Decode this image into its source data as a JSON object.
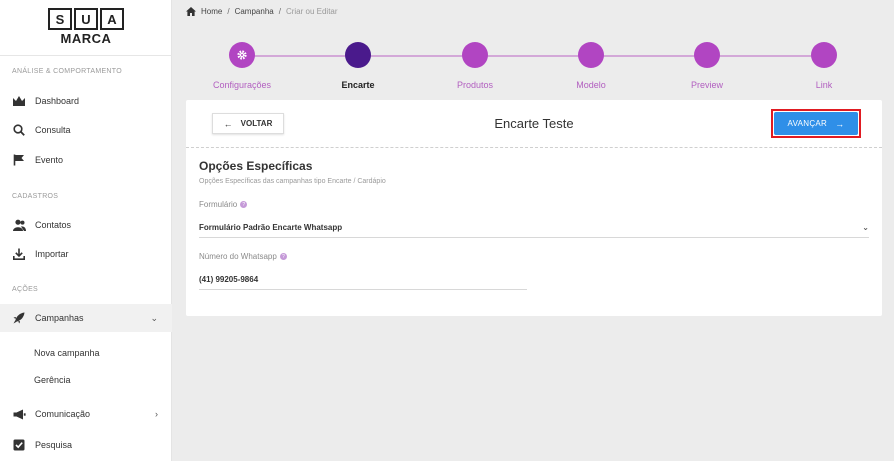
{
  "brand": {
    "letters": [
      "S",
      "U",
      "A"
    ],
    "word": "MARCA"
  },
  "sidebar": {
    "sections": [
      {
        "title": "ANÁLISE & COMPORTAMENTO"
      },
      {
        "title": "CADASTROS"
      },
      {
        "title": "AÇÕES"
      }
    ],
    "items": [
      {
        "label": "Dashboard"
      },
      {
        "label": "Consulta"
      },
      {
        "label": "Evento"
      },
      {
        "label": "Contatos"
      },
      {
        "label": "Importar"
      },
      {
        "label": "Campanhas"
      },
      {
        "label": "Comunicação"
      },
      {
        "label": "Pesquisa"
      }
    ],
    "subitems": [
      {
        "label": "Nova campanha"
      },
      {
        "label": "Gerência"
      }
    ]
  },
  "breadcrumb": {
    "home": "Home",
    "section": "Campanha",
    "current": "Criar ou Editar"
  },
  "stepper": {
    "steps": [
      {
        "label": "Configurações"
      },
      {
        "label": "Encarte"
      },
      {
        "label": "Produtos"
      },
      {
        "label": "Modelo"
      },
      {
        "label": "Preview"
      },
      {
        "label": "Link"
      }
    ],
    "current_index": 1
  },
  "card": {
    "back_label": "VOLTAR",
    "title": "Encarte Teste",
    "next_label": "AVANÇAR",
    "section_title": "Opções Específicas",
    "section_subtitle": "Opções Específicas das campanhas tipo Encarte / Cardápio",
    "form_label": "Formulário",
    "form_value": "Formulário Padrão Encarte Whatsapp",
    "whatsapp_label": "Número do Whatsapp",
    "whatsapp_value": "(41) 99205-9864"
  },
  "colors": {
    "accent_purple": "#b145c2",
    "current_step": "#4a1a8c",
    "primary_button": "#2f8fe8",
    "highlight_frame": "#e01b22"
  }
}
